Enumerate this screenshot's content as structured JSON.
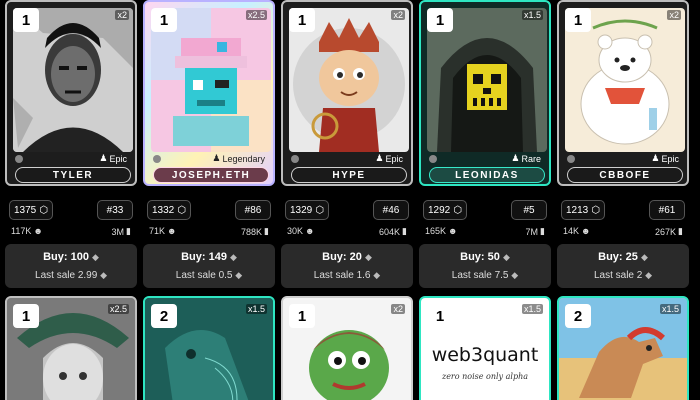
{
  "cards": [
    {
      "rank": "1",
      "multiplier": "x2",
      "rarity": "Epic",
      "name": "TYLER",
      "score": "1375",
      "rank_no": "#33",
      "holders": "117K",
      "volume": "3M",
      "buy": "Buy: 100",
      "last_sale": "Last sale 2.99"
    },
    {
      "rank": "1",
      "multiplier": "x2.5",
      "rarity": "Legendary",
      "name": "JOSEPH.ETH",
      "score": "1332",
      "rank_no": "#86",
      "holders": "71K",
      "volume": "788K",
      "buy": "Buy: 149",
      "last_sale": "Last sale 0.5"
    },
    {
      "rank": "1",
      "multiplier": "x2",
      "rarity": "Epic",
      "name": "HYPE",
      "score": "1329",
      "rank_no": "#46",
      "holders": "30K",
      "volume": "604K",
      "buy": "Buy: 20",
      "last_sale": "Last sale 1.6"
    },
    {
      "rank": "1",
      "multiplier": "x1.5",
      "rarity": "Rare",
      "name": "LEONIDAS",
      "score": "1292",
      "rank_no": "#5",
      "holders": "165K",
      "volume": "7M",
      "buy": "Buy: 50",
      "last_sale": "Last sale 7.5"
    },
    {
      "rank": "1",
      "multiplier": "x2",
      "rarity": "Epic",
      "name": "CBBOFE",
      "score": "1213",
      "rank_no": "#61",
      "holders": "14K",
      "volume": "267K",
      "buy": "Buy: 25",
      "last_sale": "Last sale 2"
    }
  ],
  "row2": [
    {
      "rank": "1",
      "multiplier": "x2.5"
    },
    {
      "rank": "2",
      "multiplier": "x1.5"
    },
    {
      "rank": "1",
      "multiplier": "x2"
    },
    {
      "rank": "1",
      "multiplier": "x1.5",
      "title": "web3quant",
      "subtitle": "zero noise only alpha"
    },
    {
      "rank": "2",
      "multiplier": "x1.5"
    }
  ],
  "icons": {
    "score": "hexagon-icon",
    "holders": "users-icon",
    "volume": "bar-chart-icon",
    "currency": "eth-icon"
  },
  "colors": {
    "background": "#000000",
    "buy_box": "#2a2a2a",
    "teal_border": "#2ee6c2",
    "holo_border": "#b9b2ff"
  }
}
